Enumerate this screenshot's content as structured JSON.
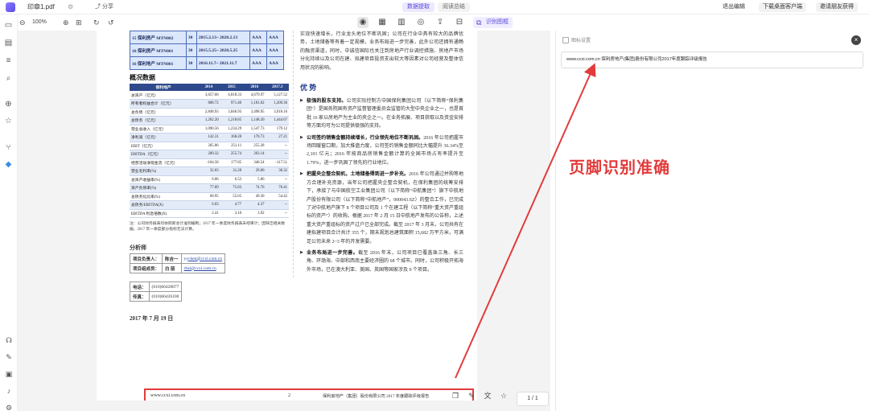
{
  "topbar": {
    "file_tab": "印章1.pdf",
    "share": "分享",
    "segments": [
      "数据提取",
      "阅读总结"
    ],
    "right": [
      "退出编辑",
      "下载桌面客户端",
      "邀请朋友获得"
    ]
  },
  "toolbar": {
    "zoom": "100%",
    "ocr_label": "识别图框"
  },
  "bonds": [
    {
      "name": "15 保利房产 MTN002",
      "term": "30",
      "date": "2015.2.13~ 2020.2.13",
      "r1": "AAA",
      "r2": "AAA"
    },
    {
      "name": "16 保利房产 MTN001",
      "term": "30",
      "date": "2015.5.25~ 2020.5.25",
      "r1": "AAA",
      "r2": "AAA"
    },
    {
      "name": "16 保利地产 MTN001",
      "term": "30",
      "date": "2016.11.7~ 2021.11.7",
      "r1": "AAA",
      "r2": "AAA"
    }
  ],
  "overview": {
    "title": "概况数据",
    "headers": [
      "保利地产",
      "2014",
      "2015",
      "2016",
      "2017.3"
    ],
    "rows": [
      [
        "总资产（亿元）",
        "3,657.66",
        "4,018.33",
        "4,679.97",
        "5,127.52"
      ],
      [
        "所有者权益合计（亿元）",
        "808.72",
        "971.40",
        "1,181.02",
        "1,209.36"
      ],
      [
        "总负债（亿元）",
        "2,848.93",
        "3,046.93",
        "3,498.95",
        "3,918.16"
      ],
      [
        "总债务（亿元）",
        "1,262.20",
        "1,218.85",
        "1,148.20",
        "1,444.67"
      ],
      [
        "营业总收入（亿元）",
        "1,090.56",
        "1,234.29",
        "1,547.73",
        "179.12"
      ],
      [
        "净利润（亿元）",
        "142.31",
        "168.28",
        "170.73",
        "27.21"
      ],
      [
        "EBIT（亿元）",
        "205.86",
        "251.11",
        "255.28",
        "--"
      ],
      [
        "EBITDA（亿元）",
        "209.32",
        "255.74",
        "263.14",
        "--"
      ],
      [
        "经营活动净现金流（亿元）",
        "-104.58",
        "177.85",
        "340.54",
        "-117.51"
      ],
      [
        "营业毛利率(%)",
        "32.03",
        "31.20",
        "29.00",
        "38.32"
      ],
      [
        "总资产收益率(%)",
        "6.06",
        "6.53",
        "5.86",
        "--"
      ],
      [
        "资产负债率(%)",
        "77.89",
        "75.83",
        "74.76",
        "76.41"
      ],
      [
        "总债务化比率(%)",
        "60.95",
        "55.65",
        "49.30",
        "54.42"
      ],
      [
        "总债务/EBITDA(X)",
        "6.03",
        "4.77",
        "4.37",
        "--"
      ],
      [
        "EBITDA 利息倍数(X)",
        "2.41",
        "3.18",
        "3.92",
        "--"
      ]
    ],
    "note": "注：公司财务报表均依照新会计准则编制；2017 年一季度财务报表未经审计；因缺乏相关数据，2017 年一季度部分指标无法计算。"
  },
  "analyst": {
    "title": "分析师",
    "rows": [
      {
        "role": "项目负责人：",
        "name": "陈吉一",
        "email": "yychen@ccxi.com.cn"
      },
      {
        "role": "项目组成员：",
        "name": "白  丽",
        "email": "rbai@ccxi.com.cn"
      }
    ],
    "phone_label": "电话：",
    "phone": "(010)66428877",
    "fax_label": "传真：",
    "fax": "(010)66426100",
    "date": "2017 年 7 月 19 日"
  },
  "right_col": {
    "intro": "实现快速增长，行业龙头地位不断巩固；公司在行业中具有较大的品牌优势，土地储备等有着一定规模，业务布局进一步完善，此外公司还拥有通畅的融资渠道，同时，中诚信国际也关注到房地产行业调控措施、房地产市场分化持续以及公司在建、拟建项目投资支出较大等因素对公司经营及整体信用状况的影响。",
    "adv_title": "优  势",
    "bullets": [
      {
        "head": "极强的股东支持。",
        "body": "公司实际控制方中国保利集团公司（以下简称“保利集团”）是国务院国有资产监督管理委员会监管的大型中央企业之一，也是首批 16 家以房地产为主业的央企之一。在业务拓展、项目获取以及资金安排等方面均可为公司提供极强的支持。"
      },
      {
        "head": "公司签约销售金额持续增长，行业领先地位不断巩固。",
        "body": "2016 年公司把握市场回暖窗口期，加大推盘力度，公司签约销售金额同比大幅提升 36.34%至 2,101 亿元；2016 年按商品房销售金额计算的全国市场占有率提升至 1.79%，进一步巩固了领先的行业地位。"
      },
      {
        "head": "把握央企整合契机，土地储备得到进一步补充。",
        "body": "2016 年公司通过并购等地方合理补充资源，当年公司把握央企整合契机，在保利集团的统筹安排下，承接了与中国航空工业集团公司（以下简称“中航集团”）旗下中航地产股份有限公司（以下简称“中航地产”，000043.SZ）的整合工作，已完成了对中航地产旗下 8 个项目公司及 1 个在建工程（以下简称“重大资产重组标的资产”）的收购。根据 2017 年 2 月 15 日中航地产发布的公告称，上述重大资产重组标的资产过户已全部完成。截至 2017 年 3 月末，公司共有在建拟建项目合计共计 355 个，期末规划总建筑面积 15,682 万平方米，可满足公司未来 2~3 年的开发需要。"
      },
      {
        "head": "业务布局进一步完善。",
        "body": "截至 2016 年末，公司项目已覆盖珠三角、长三角、环渤海、中部和西南主要经济圈的 68 个城市。同时，公司积极开拓海外市场，已在澳大利亚、美国、英国等国家涉及 9 个项目。"
      }
    ]
  },
  "footer": {
    "url": "www.ccxi.com.cn",
    "page_num": "2",
    "title": "保利房地产（集团）股份有限公司 2017 年度跟踪评级报告"
  },
  "pager": {
    "text": "1   / 1"
  },
  "panel": {
    "header": "图标设置",
    "result": "www.ccxi.com.cn 保利房地产(集团)股份有限公司2017年度跟踪评级报告"
  },
  "annotation": "页脚识别准确",
  "colors": {
    "accent": "#5a4bd8",
    "annotation": "#e23b3b",
    "table_header": "#2e4a8c"
  }
}
